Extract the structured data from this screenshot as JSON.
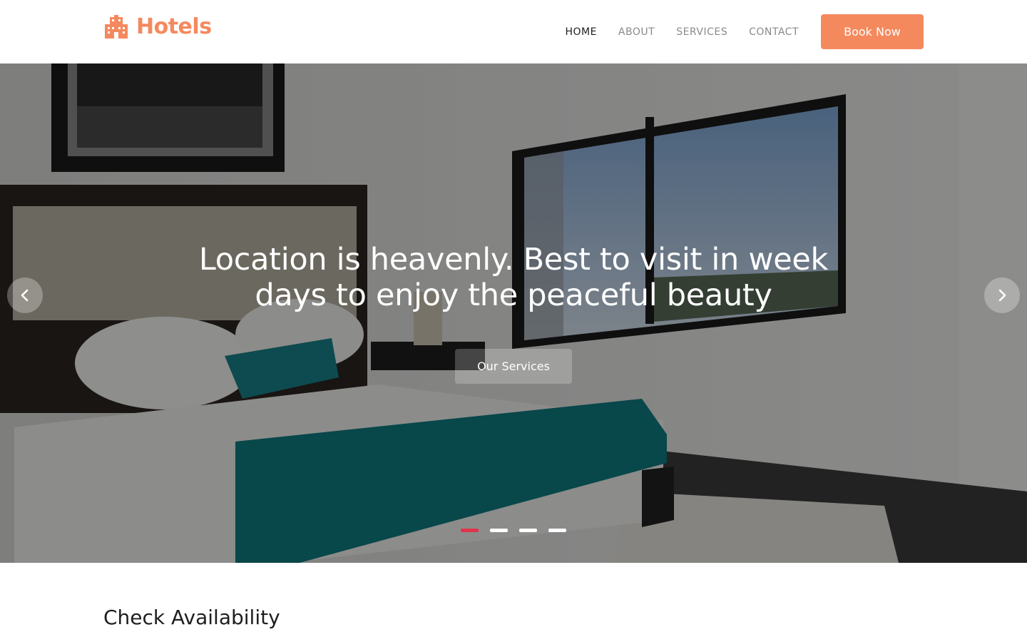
{
  "brand": {
    "name": "Hotels",
    "icon": "hotel-building-icon",
    "color": "#f5895e"
  },
  "nav": {
    "items": [
      {
        "label": "HOME",
        "active": true
      },
      {
        "label": "ABOUT",
        "active": false
      },
      {
        "label": "SERVICES",
        "active": false
      },
      {
        "label": "CONTACT",
        "active": false
      }
    ],
    "cta_label": "Book Now"
  },
  "hero": {
    "title_line1": "Location is heavenly. Best to visit in week",
    "title_line2": "days to enjoy the peaceful beauty",
    "button_label": "Our Services",
    "prev_icon": "chevron-left-icon",
    "next_icon": "chevron-right-icon",
    "slide_count": 4,
    "active_slide": 1,
    "active_dot_color": "#e0344a"
  },
  "availability": {
    "title": "Check Availability"
  }
}
